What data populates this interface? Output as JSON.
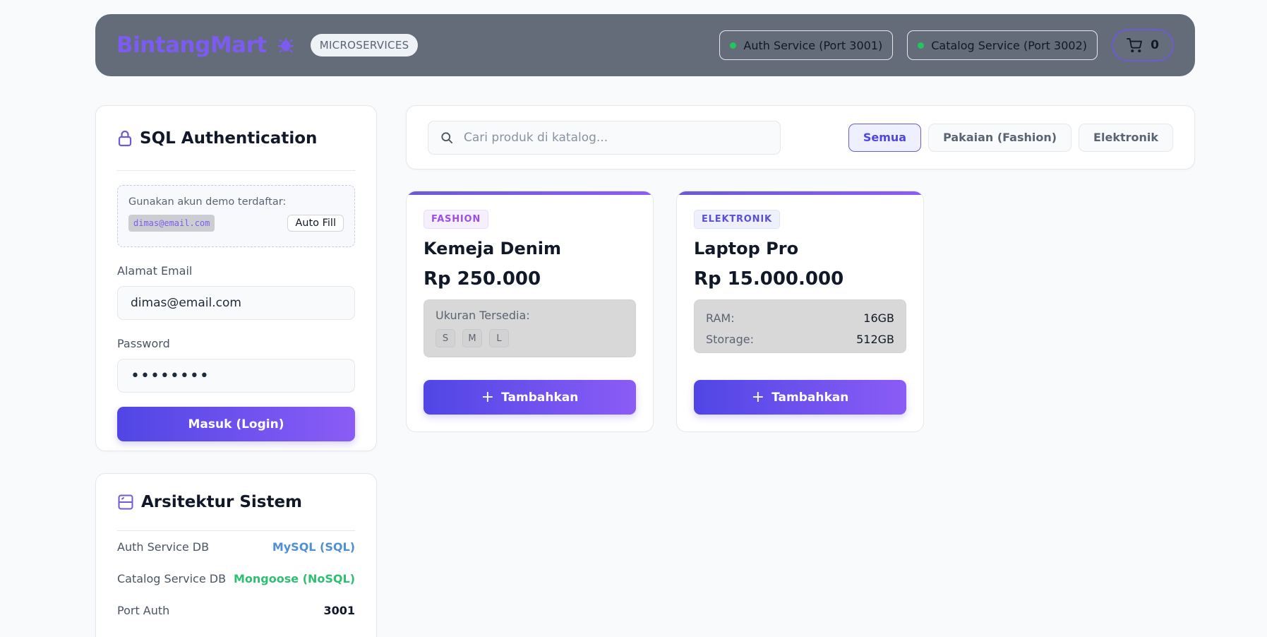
{
  "header": {
    "brand": "BintangMart",
    "badge": "MICROSERVICES",
    "services": [
      {
        "label": "Auth Service (Port 3001)"
      },
      {
        "label": "Catalog Service (Port 3002)"
      }
    ],
    "cart_count": "0"
  },
  "auth": {
    "title": "SQL Authentication",
    "demo_hint": "Gunakan akun demo terdaftar:",
    "demo_email": "dimas@email.com",
    "autofill_label": "Auto Fill",
    "email_label": "Alamat Email",
    "email_value": "dimas@email.com",
    "password_label": "Password",
    "password_value": "••••••••",
    "login_label": "Masuk (Login)"
  },
  "arch": {
    "title": "Arsitektur Sistem",
    "rows": [
      {
        "key": "Auth Service DB",
        "value": "MySQL (SQL)",
        "color": "#4f8fd6"
      },
      {
        "key": "Catalog Service DB",
        "value": "Mongoose (NoSQL)",
        "color": "#2fbf71"
      },
      {
        "key": "Port Auth",
        "value": "3001",
        "color": "#111827"
      }
    ]
  },
  "catalog": {
    "search_placeholder": "Cari produk di katalog...",
    "filters": [
      "Semua",
      "Pakaian (Fashion)",
      "Elektronik"
    ],
    "active_filter": "Semua"
  },
  "products": [
    {
      "category": "FASHION",
      "name": "Kemeja Denim",
      "price": "Rp 250.000",
      "sizes_label": "Ukuran Tersedia:",
      "sizes": [
        "S",
        "M",
        "L"
      ],
      "add_label": "Tambahkan"
    },
    {
      "category": "ELEKTRONIK",
      "name": "Laptop Pro",
      "price": "Rp 15.000.000",
      "specs": [
        {
          "key": "RAM:",
          "value": "16GB"
        },
        {
          "key": "Storage:",
          "value": "512GB"
        }
      ],
      "add_label": "Tambahkan"
    }
  ],
  "colors": {
    "accent": "#6d5bd0",
    "gradient_start": "#5046e5",
    "gradient_end": "#8b5cf6",
    "header_bg": "#656c79",
    "status_dot": "#22c55e"
  }
}
